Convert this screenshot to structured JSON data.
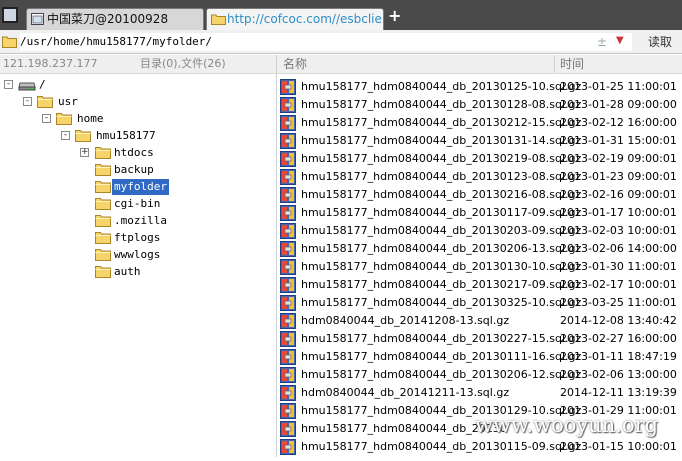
{
  "tabs": [
    {
      "label": "中国菜刀@20100928"
    },
    {
      "label": "http://cofcoc.com//esbclient..."
    }
  ],
  "address": {
    "path": "/usr/home/hmu158177/myfolder/",
    "separator": "±",
    "read_label": "读取"
  },
  "status": {
    "ip": "121.198.237.177",
    "counts": "目录(0),文件(26)"
  },
  "columns": {
    "name": "名称",
    "time": "时间"
  },
  "tree": [
    {
      "label": "/",
      "level": 0,
      "expander": "-",
      "kind": "drive"
    },
    {
      "label": "usr",
      "level": 1,
      "expander": "-"
    },
    {
      "label": "home",
      "level": 2,
      "expander": "-"
    },
    {
      "label": "hmu158177",
      "level": 3,
      "expander": "-"
    },
    {
      "label": "htdocs",
      "level": 4,
      "expander": "+"
    },
    {
      "label": "backup",
      "level": 4
    },
    {
      "label": "myfolder",
      "level": 4,
      "selected": true
    },
    {
      "label": "cgi-bin",
      "level": 4
    },
    {
      "label": ".mozilla",
      "level": 4
    },
    {
      "label": "ftplogs",
      "level": 4
    },
    {
      "label": "wwwlogs",
      "level": 4
    },
    {
      "label": "auth",
      "level": 4
    }
  ],
  "files": [
    {
      "name": "hmu158177_hdm0840044_db_20130125-10.sql.gz",
      "time": "2013-01-25 11:00:01"
    },
    {
      "name": "hmu158177_hdm0840044_db_20130128-08.sql.gz",
      "time": "2013-01-28 09:00:00"
    },
    {
      "name": "hmu158177_hdm0840044_db_20130212-15.sql.gz",
      "time": "2013-02-12 16:00:00"
    },
    {
      "name": "hmu158177_hdm0840044_db_20130131-14.sql.gz",
      "time": "2013-01-31 15:00:01"
    },
    {
      "name": "hmu158177_hdm0840044_db_20130219-08.sql.gz",
      "time": "2013-02-19 09:00:01"
    },
    {
      "name": "hmu158177_hdm0840044_db_20130123-08.sql.gz",
      "time": "2013-01-23 09:00:01"
    },
    {
      "name": "hmu158177_hdm0840044_db_20130216-08.sql.gz",
      "time": "2013-02-16 09:00:01"
    },
    {
      "name": "hmu158177_hdm0840044_db_20130117-09.sql.gz",
      "time": "2013-01-17 10:00:01"
    },
    {
      "name": "hmu158177_hdm0840044_db_20130203-09.sql.gz",
      "time": "2013-02-03 10:00:01"
    },
    {
      "name": "hmu158177_hdm0840044_db_20130206-13.sql.gz",
      "time": "2013-02-06 14:00:00"
    },
    {
      "name": "hmu158177_hdm0840044_db_20130130-10.sql.gz",
      "time": "2013-01-30 11:00:01"
    },
    {
      "name": "hmu158177_hdm0840044_db_20130217-09.sql.gz",
      "time": "2013-02-17 10:00:01"
    },
    {
      "name": "hmu158177_hdm0840044_db_20130325-10.sql.gz",
      "time": "2013-03-25 11:00:01"
    },
    {
      "name": "hdm0840044_db_20141208-13.sql.gz",
      "time": "2014-12-08 13:40:42"
    },
    {
      "name": "hmu158177_hdm0840044_db_20130227-15.sql.gz",
      "time": "2013-02-27 16:00:00"
    },
    {
      "name": "hmu158177_hdm0840044_db_20130111-16.sql.gz",
      "time": "2013-01-11 18:47:19"
    },
    {
      "name": "hmu158177_hdm0840044_db_20130206-12.sql.gz",
      "time": "2013-02-06 13:00:00"
    },
    {
      "name": "hdm0840044_db_20141211-13.sql.gz",
      "time": "2014-12-11 13:19:39"
    },
    {
      "name": "hmu158177_hdm0840044_db_20130129-10.sql.gz",
      "time": "2013-01-29 11:00:01"
    },
    {
      "name": "hmu158177_hdm0840044_db_20130",
      "time": ""
    },
    {
      "name": "hmu158177_hdm0840044_db_20130115-09.sql.gz",
      "time": "2013-01-15 10:00:01"
    }
  ],
  "watermark": "www.wooyun.org",
  "colors": {
    "tabbar": "#4a4a4a",
    "selection": "#316ac5",
    "tab_url": "#2e8ec7"
  }
}
